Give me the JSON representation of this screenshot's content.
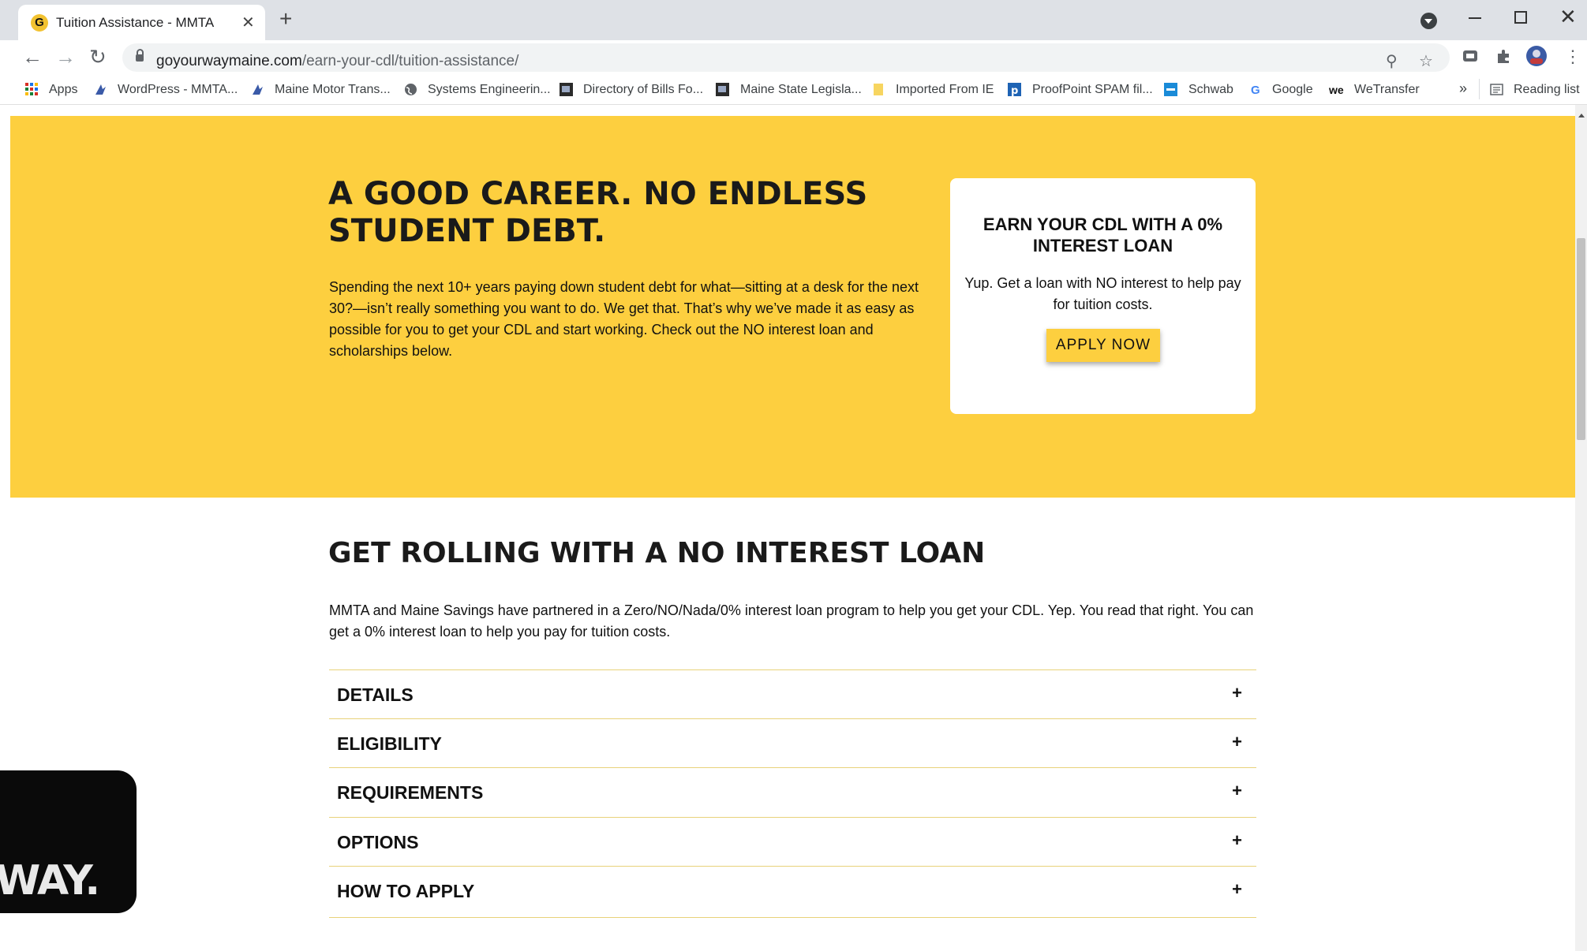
{
  "browser": {
    "tab_title": "Tuition Assistance - MMTA",
    "tab_favicon": "G",
    "url_domain": "goyourwaymaine.com",
    "url_path": "/earn-your-cdl/tuition-assistance/",
    "bookmarks": [
      "Apps",
      "WordPress - MMTA...",
      "Maine Motor Trans...",
      "Systems Engineerin...",
      "Directory of Bills Fo...",
      "Maine State Legisla...",
      "Imported From IE",
      "ProofPoint SPAM fil...",
      "Schwab",
      "Google",
      "WeTransfer"
    ],
    "bookmarks_overflow": "»",
    "reading_list": "Reading list"
  },
  "hero": {
    "heading": "A GOOD CAREER. NO ENDLESS STUDENT DEBT.",
    "paragraph": "Spending the next 10+ years paying down student debt for what—sitting at a desk for the next 30?—isn’t really something you want to do. We get that. That’s why we’ve made it as easy as possible for you to get your CDL and start working. Check out the NO interest loan and scholarships below."
  },
  "card": {
    "title": "EARN YOUR CDL WITH A 0% INTEREST LOAN",
    "paragraph": "Yup. Get a loan with NO interest to help pay for tuition costs.",
    "button": "APPLY NOW"
  },
  "loan": {
    "heading": "GET ROLLING WITH A NO INTEREST LOAN",
    "paragraph": "MMTA and Maine Savings have partnered in a Zero/NO/Nada/0% interest loan program to help you get your CDL. Yep. You read that right. You can get a 0% interest loan to help you pay for tuition costs.",
    "accordion": [
      "DETAILS",
      "ELIGIBILITY",
      "REQUIREMENTS",
      "OPTIONS",
      "HOW TO APPLY"
    ],
    "plus": "+"
  },
  "badge": {
    "text": "WAY."
  },
  "colors": {
    "brand_yellow": "#fdcf3f",
    "text": "#111111"
  }
}
